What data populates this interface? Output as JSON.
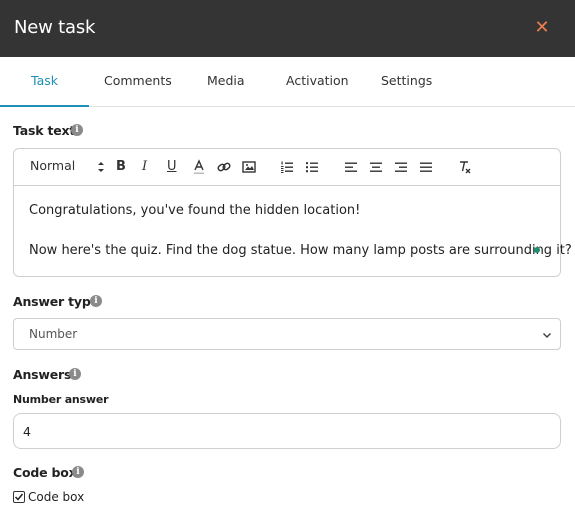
{
  "dialog": {
    "title": "New task",
    "close_icon": "close-icon",
    "close_glyph": "✕",
    "accent_color": "#1f8fb5",
    "close_color": "#ee7e4f"
  },
  "tabs": [
    {
      "label": "Task",
      "active": true
    },
    {
      "label": "Comments",
      "active": false
    },
    {
      "label": "Media",
      "active": false
    },
    {
      "label": "Activation",
      "active": false
    },
    {
      "label": "Settings",
      "active": false
    }
  ],
  "task_text": {
    "label": "Task text",
    "toolbar": {
      "format_select": "Normal",
      "buttons": [
        "bold-icon",
        "italic-icon",
        "underline-icon",
        "text-color-icon",
        "link-icon",
        "image-icon",
        "ordered-list-icon",
        "bullet-list-icon",
        "align-left-icon",
        "align-center-icon",
        "align-right-icon",
        "align-justify-icon",
        "clear-formatting-icon"
      ]
    },
    "content": [
      "Congratulations, you've found the hidden location!",
      "Now here's the quiz. Find the dog statue. How many lamp posts are surrounding it?"
    ]
  },
  "answer_type": {
    "label": "Answer type",
    "selected": "Number"
  },
  "answers": {
    "label": "Answers",
    "number_answer_label": "Number answer",
    "value": "4"
  },
  "code_box": {
    "label": "Code box",
    "checkbox_label": "Code box",
    "checked": true
  }
}
